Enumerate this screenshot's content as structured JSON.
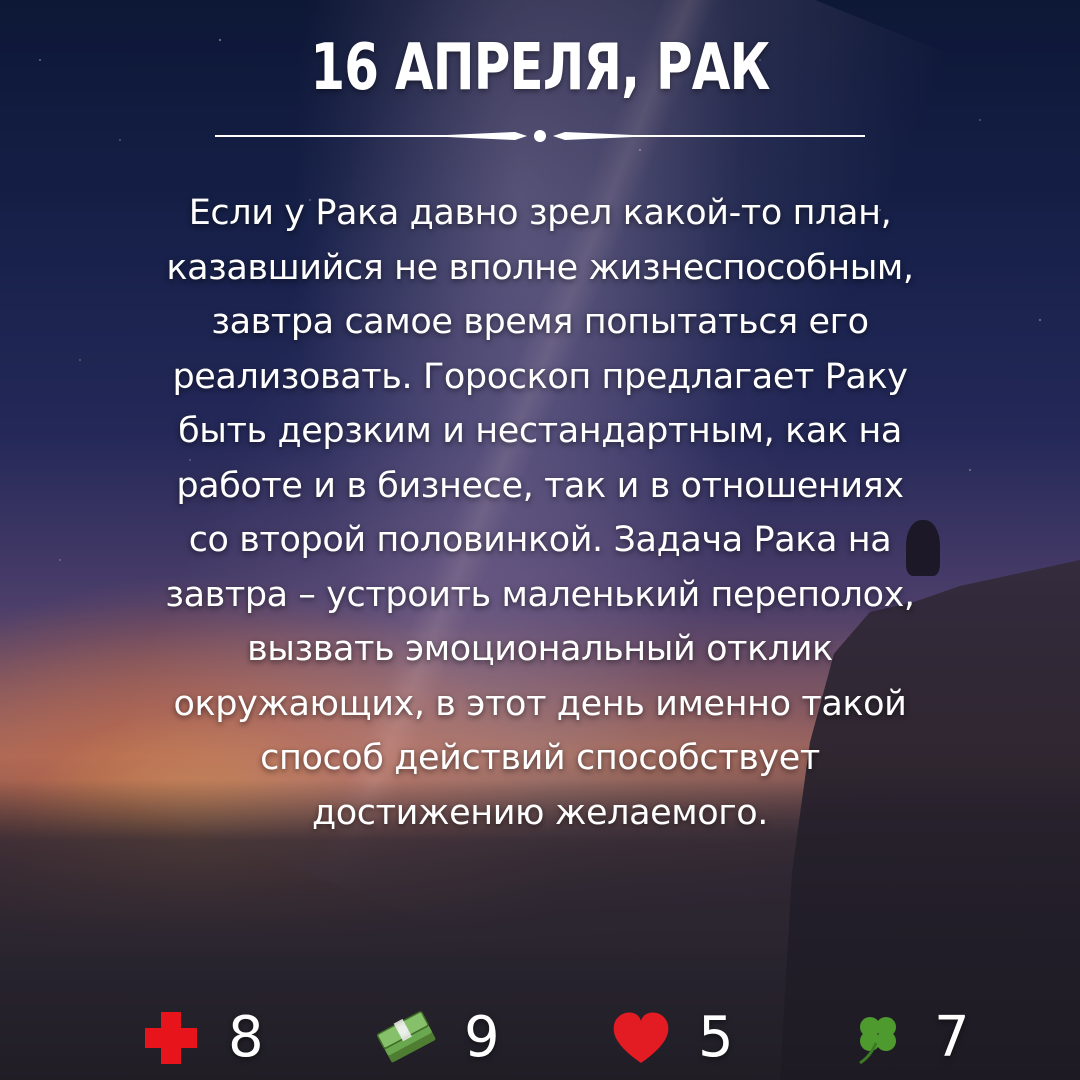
{
  "header": {
    "title": "16 АПРЕЛЯ, РАК"
  },
  "forecast": {
    "lines": [
      "Если у Рака давно зрел какой-то план,",
      "казавшийся не вполне жизнеспособным,",
      "завтра самое время попытаться его",
      "реализовать. Гороскоп предлагает Раку",
      "быть дерзким и нестандартным, как на",
      "работе и в бизнесе, так и в отношениях",
      "со второй половинкой. Задача Рака на",
      "завтра – устроить маленький переполох,",
      "вызвать эмоциональный отклик",
      "окружающих, в этот день именно такой",
      "способ действий способствует",
      "достижению желаемого."
    ]
  },
  "ratings": [
    {
      "icon": "health-cross-icon",
      "value": "8",
      "color": "#e8141b"
    },
    {
      "icon": "money-stack-icon",
      "value": "9",
      "color": "#6aa84f"
    },
    {
      "icon": "heart-icon",
      "value": "5",
      "color": "#e31b23"
    },
    {
      "icon": "four-leaf-clover-icon",
      "value": "7",
      "color": "#4e9a2f"
    }
  ]
}
